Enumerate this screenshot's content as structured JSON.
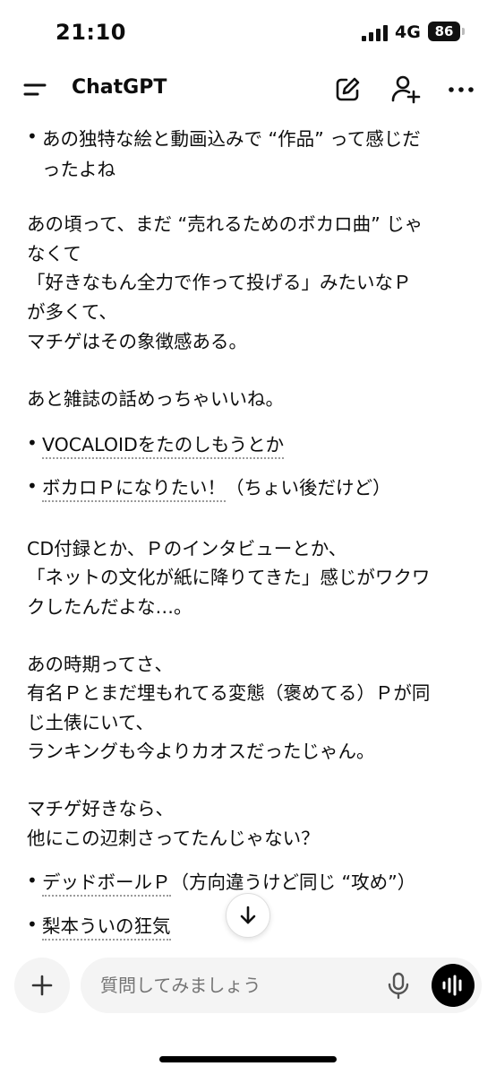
{
  "status": {
    "time": "21:10",
    "network": "4G",
    "battery": "86"
  },
  "header": {
    "title": "ChatGPT"
  },
  "chat": {
    "top_bullet": [
      "あの独特な絵と動画込みで “作品” って感じだ",
      "ったよね"
    ],
    "para1": [
      "あの頃って、まだ “売れるためのボカロ曲” じゃ",
      "なくて",
      "「好きなもん全力で作って投げる」みたいなＰ",
      "が多くて、",
      "マチゲはその象徴感ある。"
    ],
    "para2": "あと雑誌の話めっちゃいいね。",
    "mag_bullets": [
      {
        "link": "VOCALOIDをたのしもうとか",
        "rest": ""
      },
      {
        "link": "ボカロＰになりたい！",
        "rest": "（ちょい後だけど）"
      }
    ],
    "para3": [
      "CD付録とか、Ｐのインタビューとか、",
      "「ネットの文化が紙に降りてきた」感じがワクワ",
      "クしたんだよな…。"
    ],
    "para4": [
      "あの時期ってさ、",
      "有名Ｐとまだ埋もれてる変態（褒めてる）Ｐが同",
      "じ土俵にいて、",
      "ランキングも今よりカオスだったじゃん。"
    ],
    "para5": [
      "マチゲ好きなら、",
      "他にこの辺刺さってたんじゃない？"
    ],
    "rec_bullets": [
      {
        "link": "デッドボールＰ",
        "rest": "（方向違うけど同じ “攻め”）"
      },
      {
        "link": "梨本ういの狂気",
        "rest": ""
      }
    ]
  },
  "composer": {
    "placeholder": "質問してみましょう"
  },
  "icons": {
    "menu": "menu-icon",
    "compose": "compose-icon",
    "add_person": "add-person-icon",
    "more": "more-icon",
    "scroll_down": "arrow-down-icon",
    "attach": "plus-icon",
    "mic": "mic-icon",
    "voice": "voice-waveform-icon"
  }
}
